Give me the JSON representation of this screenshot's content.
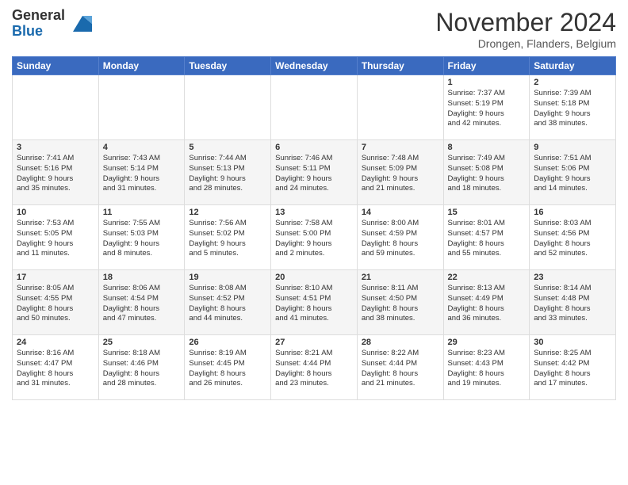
{
  "logo": {
    "general": "General",
    "blue": "Blue"
  },
  "header": {
    "month": "November 2024",
    "location": "Drongen, Flanders, Belgium"
  },
  "weekdays": [
    "Sunday",
    "Monday",
    "Tuesday",
    "Wednesday",
    "Thursday",
    "Friday",
    "Saturday"
  ],
  "weeks": [
    [
      {
        "day": "",
        "info": ""
      },
      {
        "day": "",
        "info": ""
      },
      {
        "day": "",
        "info": ""
      },
      {
        "day": "",
        "info": ""
      },
      {
        "day": "",
        "info": ""
      },
      {
        "day": "1",
        "info": "Sunrise: 7:37 AM\nSunset: 5:19 PM\nDaylight: 9 hours\nand 42 minutes."
      },
      {
        "day": "2",
        "info": "Sunrise: 7:39 AM\nSunset: 5:18 PM\nDaylight: 9 hours\nand 38 minutes."
      }
    ],
    [
      {
        "day": "3",
        "info": "Sunrise: 7:41 AM\nSunset: 5:16 PM\nDaylight: 9 hours\nand 35 minutes."
      },
      {
        "day": "4",
        "info": "Sunrise: 7:43 AM\nSunset: 5:14 PM\nDaylight: 9 hours\nand 31 minutes."
      },
      {
        "day": "5",
        "info": "Sunrise: 7:44 AM\nSunset: 5:13 PM\nDaylight: 9 hours\nand 28 minutes."
      },
      {
        "day": "6",
        "info": "Sunrise: 7:46 AM\nSunset: 5:11 PM\nDaylight: 9 hours\nand 24 minutes."
      },
      {
        "day": "7",
        "info": "Sunrise: 7:48 AM\nSunset: 5:09 PM\nDaylight: 9 hours\nand 21 minutes."
      },
      {
        "day": "8",
        "info": "Sunrise: 7:49 AM\nSunset: 5:08 PM\nDaylight: 9 hours\nand 18 minutes."
      },
      {
        "day": "9",
        "info": "Sunrise: 7:51 AM\nSunset: 5:06 PM\nDaylight: 9 hours\nand 14 minutes."
      }
    ],
    [
      {
        "day": "10",
        "info": "Sunrise: 7:53 AM\nSunset: 5:05 PM\nDaylight: 9 hours\nand 11 minutes."
      },
      {
        "day": "11",
        "info": "Sunrise: 7:55 AM\nSunset: 5:03 PM\nDaylight: 9 hours\nand 8 minutes."
      },
      {
        "day": "12",
        "info": "Sunrise: 7:56 AM\nSunset: 5:02 PM\nDaylight: 9 hours\nand 5 minutes."
      },
      {
        "day": "13",
        "info": "Sunrise: 7:58 AM\nSunset: 5:00 PM\nDaylight: 9 hours\nand 2 minutes."
      },
      {
        "day": "14",
        "info": "Sunrise: 8:00 AM\nSunset: 4:59 PM\nDaylight: 8 hours\nand 59 minutes."
      },
      {
        "day": "15",
        "info": "Sunrise: 8:01 AM\nSunset: 4:57 PM\nDaylight: 8 hours\nand 55 minutes."
      },
      {
        "day": "16",
        "info": "Sunrise: 8:03 AM\nSunset: 4:56 PM\nDaylight: 8 hours\nand 52 minutes."
      }
    ],
    [
      {
        "day": "17",
        "info": "Sunrise: 8:05 AM\nSunset: 4:55 PM\nDaylight: 8 hours\nand 50 minutes."
      },
      {
        "day": "18",
        "info": "Sunrise: 8:06 AM\nSunset: 4:54 PM\nDaylight: 8 hours\nand 47 minutes."
      },
      {
        "day": "19",
        "info": "Sunrise: 8:08 AM\nSunset: 4:52 PM\nDaylight: 8 hours\nand 44 minutes."
      },
      {
        "day": "20",
        "info": "Sunrise: 8:10 AM\nSunset: 4:51 PM\nDaylight: 8 hours\nand 41 minutes."
      },
      {
        "day": "21",
        "info": "Sunrise: 8:11 AM\nSunset: 4:50 PM\nDaylight: 8 hours\nand 38 minutes."
      },
      {
        "day": "22",
        "info": "Sunrise: 8:13 AM\nSunset: 4:49 PM\nDaylight: 8 hours\nand 36 minutes."
      },
      {
        "day": "23",
        "info": "Sunrise: 8:14 AM\nSunset: 4:48 PM\nDaylight: 8 hours\nand 33 minutes."
      }
    ],
    [
      {
        "day": "24",
        "info": "Sunrise: 8:16 AM\nSunset: 4:47 PM\nDaylight: 8 hours\nand 31 minutes."
      },
      {
        "day": "25",
        "info": "Sunrise: 8:18 AM\nSunset: 4:46 PM\nDaylight: 8 hours\nand 28 minutes."
      },
      {
        "day": "26",
        "info": "Sunrise: 8:19 AM\nSunset: 4:45 PM\nDaylight: 8 hours\nand 26 minutes."
      },
      {
        "day": "27",
        "info": "Sunrise: 8:21 AM\nSunset: 4:44 PM\nDaylight: 8 hours\nand 23 minutes."
      },
      {
        "day": "28",
        "info": "Sunrise: 8:22 AM\nSunset: 4:44 PM\nDaylight: 8 hours\nand 21 minutes."
      },
      {
        "day": "29",
        "info": "Sunrise: 8:23 AM\nSunset: 4:43 PM\nDaylight: 8 hours\nand 19 minutes."
      },
      {
        "day": "30",
        "info": "Sunrise: 8:25 AM\nSunset: 4:42 PM\nDaylight: 8 hours\nand 17 minutes."
      }
    ]
  ]
}
